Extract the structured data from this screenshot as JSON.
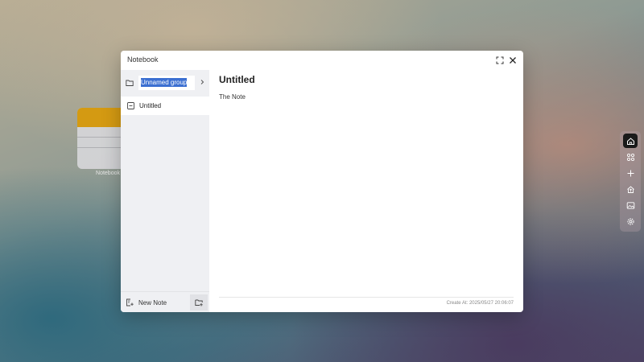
{
  "desktop": {
    "widget_label": "Notebook"
  },
  "window": {
    "title": "Notebook"
  },
  "sidebar": {
    "group_name": "Unnamed group",
    "notes": [
      {
        "label": "Untitled"
      }
    ],
    "new_note_label": "New Note"
  },
  "note": {
    "title": "Untitled",
    "body": "The Note",
    "created": "Create At: 2025/05/27 20:06:07"
  },
  "dock": {
    "items": [
      "home-icon",
      "apps-icon",
      "plus-icon",
      "upload-icon",
      "image-icon",
      "settings-icon"
    ],
    "active": "home-icon"
  },
  "colors": {
    "widget_accent": "#d49a12",
    "selection": "#3b6fd1",
    "dock_active": "#1a1a1a"
  }
}
